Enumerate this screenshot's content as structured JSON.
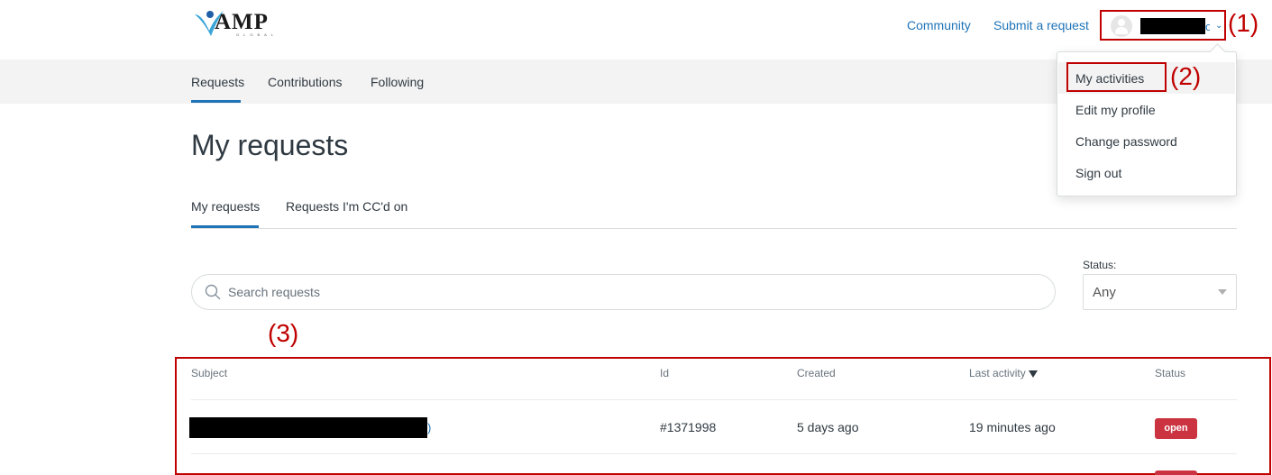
{
  "brand": {
    "logo_text": "AMP",
    "logo_sub": "GLOBAL"
  },
  "header": {
    "community_link": "Community",
    "submit_link": "Submit a request",
    "user_name_tail": "o"
  },
  "user_menu": {
    "items": [
      "My activities",
      "Edit my profile",
      "Change password",
      "Sign out"
    ]
  },
  "subnav": {
    "items": [
      "Requests",
      "Contributions",
      "Following"
    ],
    "active": "Requests"
  },
  "page": {
    "title": "My requests"
  },
  "tabs": {
    "items": [
      "My requests",
      "Requests I'm CC'd on"
    ],
    "active": "My requests"
  },
  "search": {
    "placeholder": "Search requests"
  },
  "status_filter": {
    "label": "Status:",
    "value": "Any"
  },
  "table": {
    "headers": [
      "Subject",
      "Id",
      "Created",
      "Last activity",
      "Status"
    ],
    "rows": [
      {
        "subject_tail": ")",
        "id": "#1371998",
        "created": "5 days ago",
        "last_activity": "19 minutes ago",
        "status": "open"
      }
    ]
  },
  "annotations": {
    "label_1": "(1)",
    "label_2": "(2)",
    "label_3": "(3)"
  },
  "colors": {
    "accent": "#1f73b7",
    "annotation": "#c00000",
    "badge_open": "#cc3340"
  }
}
